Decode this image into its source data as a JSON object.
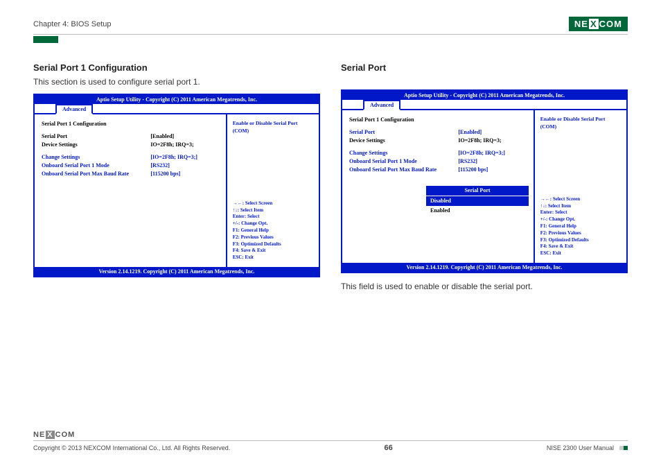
{
  "header": {
    "chapter": "Chapter 4: BIOS Setup",
    "logo_left": "NE",
    "logo_x": "X",
    "logo_right": "COM"
  },
  "left": {
    "title": "Serial Port 1 Configuration",
    "desc": "This section is used to configure serial port 1.",
    "bios": {
      "title": "Aptio Setup Utility - Copyright (C) 2011 American Megatrends, Inc.",
      "tab": "Advanced",
      "section_header": "Serial Port 1 Configuration",
      "rows": [
        {
          "label": "Serial Port",
          "value": "[Enabled]",
          "highlight": true
        },
        {
          "label": "Device Settings",
          "value": "IO=2F8h; IRQ=3;",
          "black": true
        }
      ],
      "rows2": [
        {
          "label": "Change Settings",
          "value": "[IO=2F8h; IRQ=3;]"
        },
        {
          "label": "Onboard Serial Port 1 Mode",
          "value": "[RS232]"
        },
        {
          "label": "Onboard Serial Port Max Baud Rate",
          "value": "[115200 bps]"
        }
      ],
      "help_top": "Enable or Disable Serial Port (COM)",
      "help_keys": [
        "→←: Select Screen",
        "↑↓: Select Item",
        "Enter: Select",
        "+/-: Change Opt.",
        "F1: General Help",
        "F2: Previous Values",
        "F3: Optimized Defaults",
        "F4: Save & Exit",
        "ESC: Exit"
      ],
      "footer": "Version 2.14.1219. Copyright (C) 2011 American Megatrends, Inc."
    }
  },
  "right": {
    "title": "Serial Port",
    "bios": {
      "title": "Aptio Setup Utility - Copyright (C) 2011 American Megatrends, Inc.",
      "tab": "Advanced",
      "section_header": "Serial Port 1 Configuration",
      "rows": [
        {
          "label": "Serial Port",
          "value": "[Enabled]"
        },
        {
          "label": "Device Settings",
          "value": "IO=2F8h; IRQ=3;",
          "black": true
        }
      ],
      "rows2": [
        {
          "label": "Change Settings",
          "value": "[IO=2F8h; IRQ=3;]"
        },
        {
          "label": "Onboard Serial Port 1 Mode",
          "value": "[RS232]"
        },
        {
          "label": "Onboard Serial Port Max Baud Rate",
          "value": "[115200 bps]"
        }
      ],
      "popup": {
        "title": "Serial Port",
        "options": [
          "Disabled",
          "Enabled"
        ],
        "selected": 1
      },
      "help_top": "Enable or Disable Serial Port (COM)",
      "help_keys": [
        "→←: Select Screen",
        "↑↓: Select Item",
        "Enter: Select",
        "+/-: Change Opt.",
        "F1: General Help",
        "F2: Previous Values",
        "F3: Optimized Defaults",
        "F4: Save & Exit",
        "ESC: Exit"
      ],
      "footer": "Version 2.14.1219. Copyright (C) 2011 American Megatrends, Inc."
    },
    "desc_below": "This field is used to enable or disable the serial port."
  },
  "footer": {
    "logo_left": "NE",
    "logo_x": "X",
    "logo_right": "COM",
    "copyright": "Copyright © 2013 NEXCOM International Co., Ltd. All Rights Reserved.",
    "page": "66",
    "manual": "NISE 2300 User Manual"
  }
}
